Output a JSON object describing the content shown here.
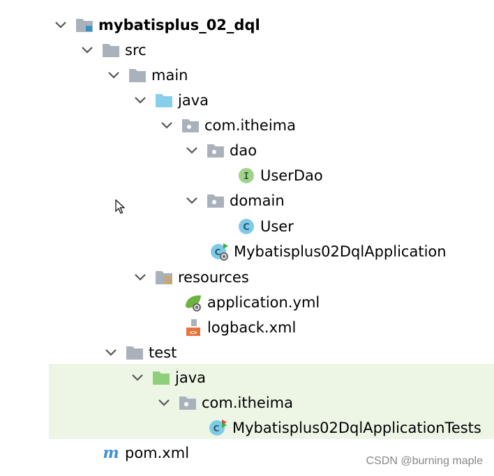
{
  "tree": {
    "root": {
      "label": "mybatisplus_02_dql",
      "icon": "module-folder-icon"
    },
    "src": {
      "label": "src"
    },
    "main": {
      "label": "main"
    },
    "main_java": {
      "label": "java"
    },
    "main_pkg": {
      "label": "com.itheima"
    },
    "dao": {
      "label": "dao"
    },
    "userdao": {
      "label": "UserDao",
      "icon": "interface-icon"
    },
    "domain": {
      "label": "domain"
    },
    "user": {
      "label": "User",
      "icon": "class-icon"
    },
    "app": {
      "label": "Mybatisplus02DqlApplication",
      "icon": "spring-boot-class-icon"
    },
    "resources": {
      "label": "resources"
    },
    "app_yml": {
      "label": "application.yml",
      "icon": "spring-config-icon"
    },
    "logback": {
      "label": "logback.xml",
      "icon": "xml-file-icon"
    },
    "test": {
      "label": "test"
    },
    "test_java": {
      "label": "java"
    },
    "test_pkg": {
      "label": "com.itheima"
    },
    "tests": {
      "label": "Mybatisplus02DqlApplicationTests",
      "icon": "test-class-icon"
    },
    "pom": {
      "label": "pom.xml",
      "icon": "maven-icon"
    }
  },
  "watermark": "CSDN @burning maple",
  "colors": {
    "folder": "#a9b2bb",
    "source_folder": "#87ceeb",
    "test_folder": "#8fce7a",
    "selection_band": "#edf6e5",
    "class": "#7fcbe6",
    "interface": "#9fd38c"
  }
}
